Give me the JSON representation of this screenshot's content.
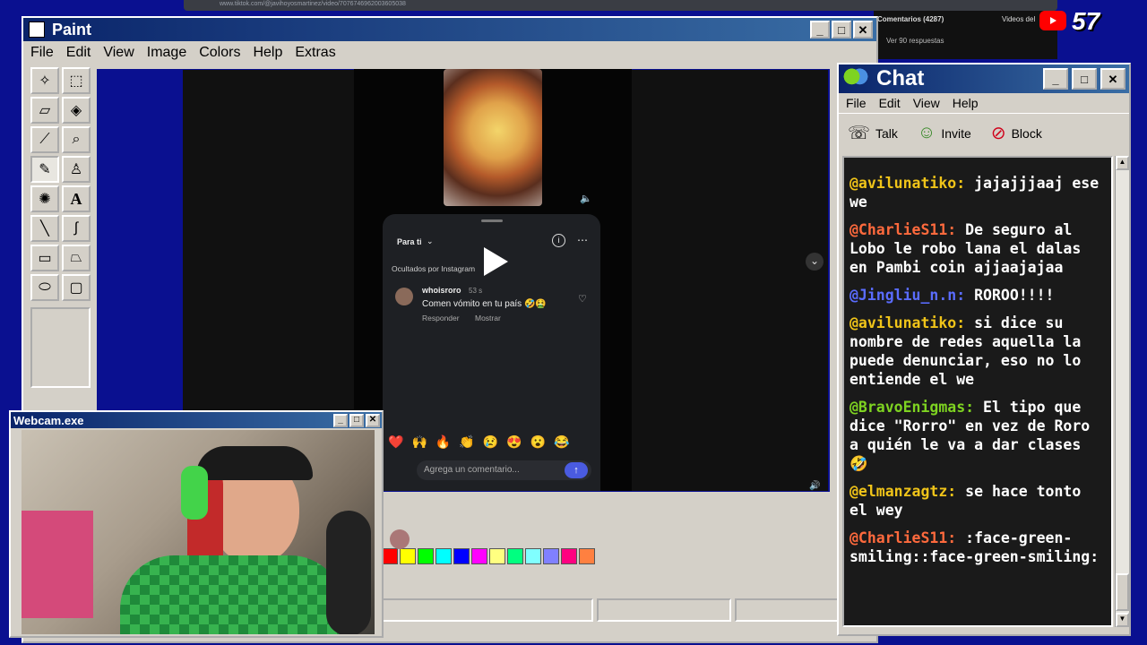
{
  "browser_bar": {
    "url": "www.tiktok.com/@javihoyosmartinez/video/7076746962003605038",
    "comments_label": "Comentarios (4287)",
    "videos_label": "Videos del",
    "replies": "Ver 90 respuestas",
    "counter": "57"
  },
  "paint": {
    "title": "Paint",
    "menu": [
      "File",
      "Edit",
      "View",
      "Image",
      "Colors",
      "Help",
      "Extras"
    ],
    "tools": [
      "star-select-icon",
      "rect-select-icon",
      "eraser-icon",
      "fill-icon",
      "picker-icon",
      "magnifier-icon",
      "pencil-icon",
      "brush-icon",
      "airbrush-icon",
      "text-icon",
      "line-icon",
      "curve-icon",
      "rectangle-icon",
      "polygon-icon",
      "ellipse-icon",
      "rounded-rect-icon"
    ],
    "palette": [
      "#ff0000",
      "#ffff00",
      "#00ff00",
      "#00ffff",
      "#0000ff",
      "#ff00ff",
      "#ffff80",
      "#00ff80",
      "#80ffff",
      "#8080ff",
      "#ff0080",
      "#ff8040"
    ]
  },
  "video": {
    "feed_label": "Para ti",
    "hidden_label": "Ocultados por Instagram",
    "comment_user": "whoisroro",
    "comment_time": "53 s",
    "comment_text": "Comen vómito en tu país 🤣🤮",
    "reply_label": "Responder",
    "show_label": "Mostrar",
    "emojis": [
      "❤️",
      "🙌",
      "🔥",
      "👏",
      "😢",
      "😍",
      "😮",
      "😂"
    ],
    "input_placeholder": "Agrega un comentario..."
  },
  "webcam": {
    "title": "Webcam.exe"
  },
  "chat": {
    "title": "Chat",
    "menu": [
      "File",
      "Edit",
      "View",
      "Help"
    ],
    "toolbar": [
      {
        "label": "Talk",
        "icon": "talk-icon"
      },
      {
        "label": "Invite",
        "icon": "invite-icon"
      },
      {
        "label": "Block",
        "icon": "block-icon"
      }
    ],
    "messages": [
      {
        "user": "@avilunatiko:",
        "color": "#f0c419",
        "text": "jajajjjaaj ese we"
      },
      {
        "user": "@CharlieS11:",
        "color": "#ff6a3d",
        "text": "De seguro al Lobo le robo lana el dalas en Pambi coin ajjaajajaa"
      },
      {
        "user": "@Jingliu_n.n:",
        "color": "#5a6cff",
        "text": "ROROO!!!!"
      },
      {
        "user": "@avilunatiko:",
        "color": "#f0c419",
        "text": "si dice su nombre de redes aquella la puede denunciar, eso no lo entiende el we"
      },
      {
        "user": "@BravoEnigmas:",
        "color": "#7ed321",
        "text": "El tipo que dice \"Rorro\" en vez de Roro a quién le va a dar clases 🤣"
      },
      {
        "user": "@elmanzagtz:",
        "color": "#f0c419",
        "text": "se hace tonto el wey"
      },
      {
        "user": "@CharlieS11:",
        "color": "#ff6a3d",
        "text": ":face-green-smiling::face-green-smiling:"
      }
    ]
  }
}
